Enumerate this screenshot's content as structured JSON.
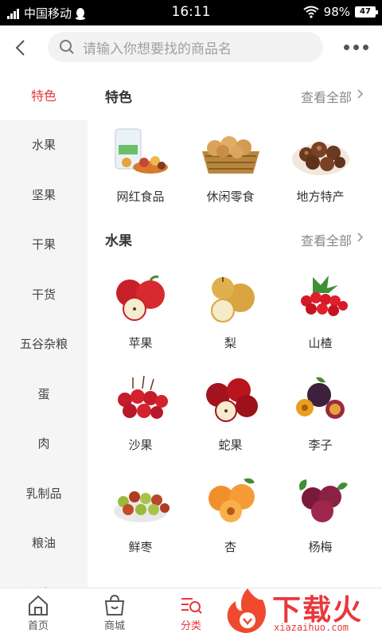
{
  "status": {
    "carrier": "中国移动",
    "time": "16:11",
    "battery": "98%",
    "battery_icon_text": "47"
  },
  "search": {
    "placeholder": "请输入你想要找的商品名"
  },
  "sidebar": {
    "items": [
      {
        "label": "特色",
        "active": true
      },
      {
        "label": "水果"
      },
      {
        "label": "坚果"
      },
      {
        "label": "干果"
      },
      {
        "label": "干货"
      },
      {
        "label": "五谷杂粮"
      },
      {
        "label": "蛋"
      },
      {
        "label": "肉"
      },
      {
        "label": "乳制品"
      },
      {
        "label": "粮油"
      },
      {
        "label": "调味品"
      }
    ]
  },
  "sections": [
    {
      "title": "特色",
      "more": "查看全部",
      "items": [
        {
          "label": "网红食品",
          "icon": "snack-bag-icon"
        },
        {
          "label": "休闲零食",
          "icon": "cookies-basket-icon"
        },
        {
          "label": "地方特产",
          "icon": "chestnuts-bowl-icon"
        }
      ]
    },
    {
      "title": "水果",
      "more": "查看全部",
      "items": [
        {
          "label": "苹果",
          "icon": "apple-icon"
        },
        {
          "label": "梨",
          "icon": "pear-icon"
        },
        {
          "label": "山楂",
          "icon": "hawthorn-icon"
        },
        {
          "label": "沙果",
          "icon": "crabapple-icon"
        },
        {
          "label": "蛇果",
          "icon": "red-delicious-icon"
        },
        {
          "label": "李子",
          "icon": "plum-icon"
        },
        {
          "label": "鲜枣",
          "icon": "jujube-icon"
        },
        {
          "label": "杏",
          "icon": "apricot-icon"
        },
        {
          "label": "杨梅",
          "icon": "bayberry-icon"
        }
      ]
    }
  ],
  "tabs": [
    {
      "label": "首页",
      "icon": "home-icon"
    },
    {
      "label": "商城",
      "icon": "shopping-bag-icon"
    },
    {
      "label": "分类",
      "icon": "category-search-icon",
      "active": true
    }
  ],
  "watermark": {
    "text": "下载火",
    "sub": "xiazaihuo.com"
  },
  "colors": {
    "accent": "#e8383d",
    "sidebar_bg": "#f5f5f5",
    "search_bg": "#f2f2f2"
  }
}
